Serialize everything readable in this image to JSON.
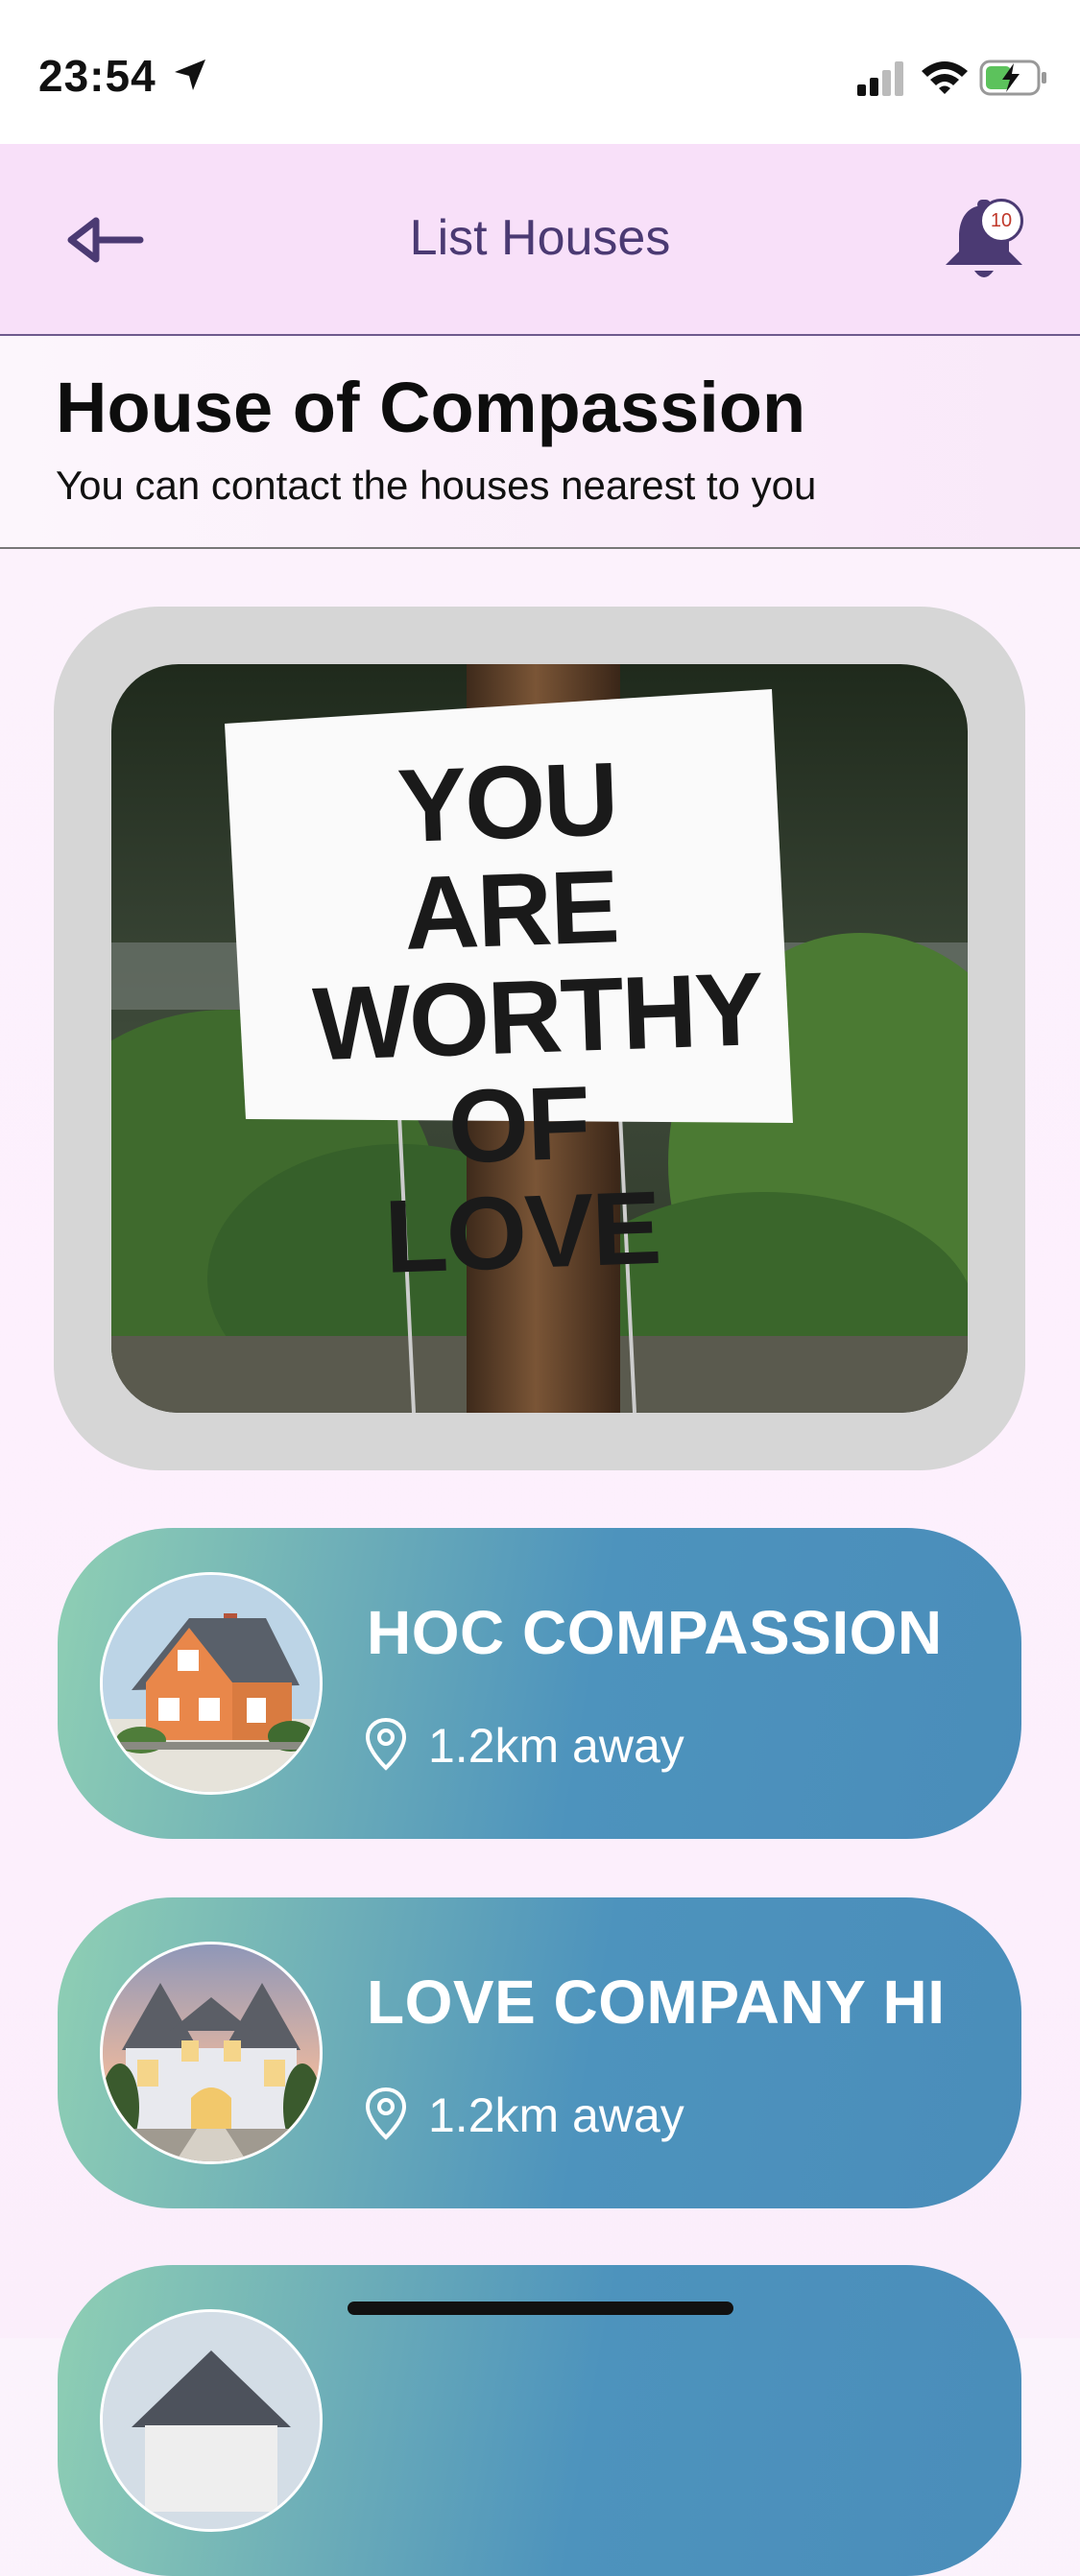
{
  "status_bar": {
    "time": "23:54"
  },
  "header": {
    "title": "List Houses",
    "notification_count": "10"
  },
  "intro": {
    "title": "House of Compassion",
    "subtitle": "You can contact the houses nearest to you"
  },
  "banner": {
    "sign_lines": [
      "YOU ARE",
      "WORTHY",
      "OF LOVE"
    ]
  },
  "houses": [
    {
      "name": "HOC COMPASSION",
      "distance": "1.2km away"
    },
    {
      "name": "LOVE COMPANY HI",
      "distance": "1.2km away"
    }
  ],
  "colors": {
    "header_bg": "#f8e0f9",
    "accent": "#4b3a73",
    "card_gradient_start": "#8fcfb4",
    "card_gradient_end": "#4a8dba"
  }
}
